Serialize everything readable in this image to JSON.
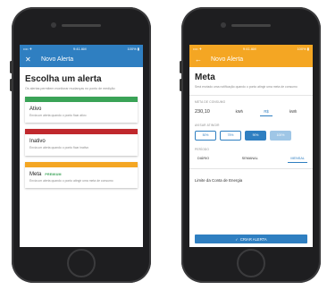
{
  "colors": {
    "blue_appbar": "#2f7fc1",
    "orange_appbar": "#f4a623",
    "ativo": "#3aa357",
    "inativo": "#c0282d",
    "meta": "#f4a623",
    "primary": "#2f7fc1"
  },
  "left": {
    "status": {
      "carrier": "•••• ✈",
      "time": "9:41 AM",
      "battery": "100% ▮"
    },
    "appbar": {
      "nav_icon": "✕",
      "title": "Novo Alerta"
    },
    "page_title": "Escolha um alerta",
    "page_desc": "Os alertas permitem monitorar mudanças no ponto de medição",
    "cards": [
      {
        "title": "Ativo",
        "badge": "",
        "desc": "Envia um alerta quando o ponto ficar ativo"
      },
      {
        "title": "Inativo",
        "badge": "",
        "desc": "Envia um alerta quando o ponto ficar inativo"
      },
      {
        "title": "Meta",
        "badge": "PREMIUM",
        "desc": "Envia um alerta quando o ponto atingir uma meta de consumo"
      }
    ]
  },
  "right": {
    "status": {
      "carrier": "•••• ✈",
      "time": "9:41 AM",
      "battery": "100% ▮"
    },
    "appbar": {
      "nav_icon": "←",
      "title": "Novo Alerta"
    },
    "page_title": "Meta",
    "page_desc": "Será enviado uma notificação quando o ponto atingir uma meta de consumo",
    "consumo": {
      "label": "META DE CONSUMO",
      "value": "230,10",
      "units": [
        "kWh",
        "R$",
        "kWh"
      ],
      "selected_unit": 1
    },
    "avisos": {
      "label": "AVISAR ATINGIR",
      "options": [
        "50%",
        "75%",
        "90%",
        "100%"
      ],
      "states": [
        "outline",
        "outline",
        "filled",
        "faded"
      ]
    },
    "periodo": {
      "label": "PERÍODO",
      "options": [
        "DIÁRIO",
        "SEMANAL",
        "MENSAL"
      ],
      "selected": 2
    },
    "limit_label": "Limite da Conta de Energia",
    "create_button": "CRIAR ALERTA",
    "create_icon": "✓"
  }
}
